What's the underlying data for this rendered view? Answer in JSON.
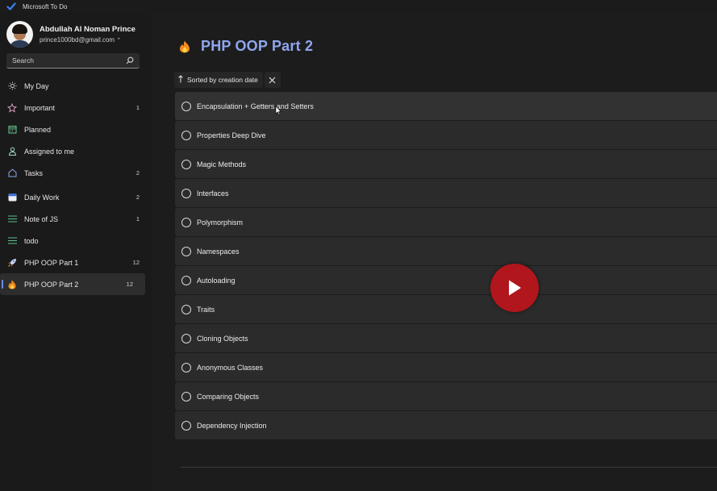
{
  "window": {
    "app_title": "Microsoft To Do"
  },
  "profile": {
    "name": "Abdullah Al Noman Prince",
    "email": "prince1000bd@gmail.com"
  },
  "search": {
    "placeholder": "Search",
    "icon": "search-icon"
  },
  "nav": {
    "my_day": {
      "label": "My Day",
      "icon": "sun-icon"
    },
    "important": {
      "label": "Important",
      "count": "1",
      "icon": "star-icon"
    },
    "planned": {
      "label": "Planned",
      "icon": "calendar-icon"
    },
    "assigned": {
      "label": "Assigned to me",
      "icon": "person-icon"
    },
    "tasks": {
      "label": "Tasks",
      "count": "2",
      "icon": "home-icon"
    },
    "lists": [
      {
        "label": "Daily Work",
        "count": "2",
        "icon": "calendar-emoji-icon"
      },
      {
        "label": "Note of JS",
        "count": "1",
        "icon": "list-lines-icon"
      },
      {
        "label": "todo",
        "count": "",
        "icon": "list-lines-icon"
      },
      {
        "label": "PHP OOP Part 1",
        "count": "12",
        "icon": "rocket-icon"
      },
      {
        "label": "PHP OOP Part 2",
        "count": "12",
        "icon": "fire-icon",
        "active": true
      }
    ]
  },
  "main": {
    "title": "PHP OOP Part 2",
    "title_color": "#8fa6ee",
    "sort_label": "Sorted by creation date",
    "tasks": [
      "Encapsulation + Getters and Setters",
      "Properties Deep Dive",
      "Magic Methods",
      "Interfaces",
      "Polymorphism",
      "Namespaces",
      "Autoloading",
      "Traits",
      "Cloning Objects",
      "Anonymous Classes",
      "Comparing Objects",
      "Dependency Injection"
    ]
  },
  "overlay": {
    "play_button_color": "#b0161c"
  }
}
